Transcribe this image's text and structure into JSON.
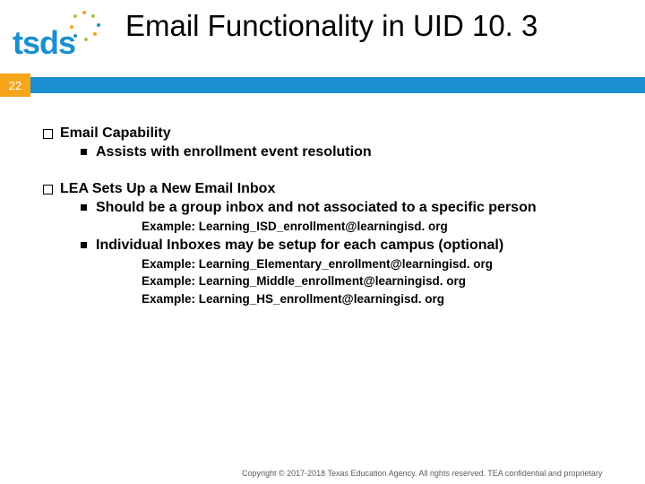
{
  "header": {
    "logo_text": "tsds",
    "title": "Email Functionality in UID 10. 3"
  },
  "page_number": "22",
  "sections": [
    {
      "heading": "Email Capability",
      "subs": [
        {
          "text": "Assists with enrollment event resolution",
          "examples": []
        }
      ]
    },
    {
      "heading": "LEA Sets Up a New Email Inbox",
      "subs": [
        {
          "text": "Should be a group inbox and not associated to a specific person",
          "examples": [
            "Example:  Learning_ISD_enrollment@learningisd. org"
          ]
        },
        {
          "text": "Individual Inboxes may be setup for each campus (optional)",
          "examples": [
            "Example:  Learning_Elementary_enrollment@learningisd. org",
            "Example:  Learning_Middle_enrollment@learningisd. org",
            "Example:  Learning_HS_enrollment@learningisd. org"
          ]
        }
      ]
    }
  ],
  "footer": "Copyright © 2017-2018 Texas Education Agency. All rights reserved. TEA confidential and proprietary"
}
